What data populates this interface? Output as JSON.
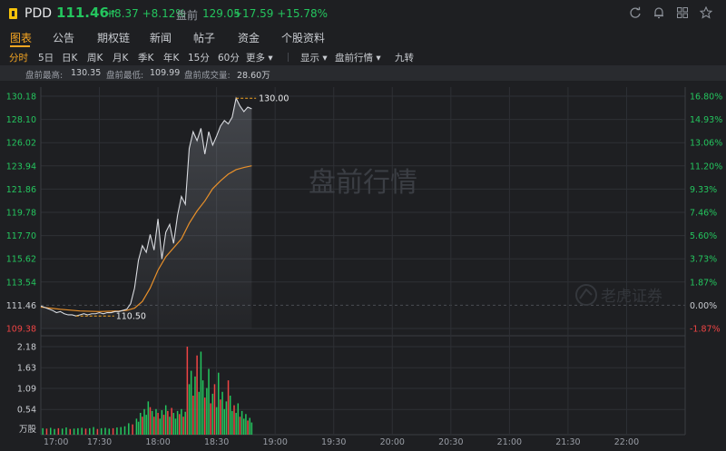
{
  "header": {
    "ticker": "PDD",
    "last_price": "111.46",
    "arrow": "↑",
    "change": "+8.37 +8.12%",
    "premarket_label": "盘前",
    "premarket_price": "129.05",
    "premarket_change": "+17.59 +15.78%",
    "icons": [
      "refresh-icon",
      "bell-icon",
      "grid-icon",
      "star-icon"
    ]
  },
  "tabs": [
    "图表",
    "公告",
    "期权链",
    "新闻",
    "帖子",
    "资金",
    "个股资料"
  ],
  "active_tab": 0,
  "periods": [
    "分时",
    "5日",
    "日K",
    "周K",
    "月K",
    "季K",
    "年K",
    "15分",
    "60分",
    "更多",
    "显示",
    "盘前行情",
    "九转"
  ],
  "active_period": 0,
  "stats": {
    "high_label": "盘前最高:",
    "high": "130.35",
    "low_label": "盘前最低:",
    "low": "109.99",
    "vol_label": "盘前成交量:",
    "vol": "28.60万"
  },
  "colors": {
    "up": "#24c55e",
    "down": "#ef4444",
    "accent": "#f5a623",
    "price_line": "#d9dbe0",
    "avg_line": "#e8902a",
    "bg": "#1e1f22"
  },
  "chart_data": {
    "type": "line",
    "watermark": "盘前行情",
    "brand": "老虎证券",
    "price_ticks": [
      "130.18",
      "128.10",
      "126.02",
      "123.94",
      "121.86",
      "119.78",
      "117.70",
      "115.62",
      "113.54",
      "111.46",
      "109.38"
    ],
    "pct_ticks": [
      "16.80%",
      "14.93%",
      "13.06%",
      "11.20%",
      "9.33%",
      "7.46%",
      "5.60%",
      "3.73%",
      "1.87%",
      "0.00%",
      "-1.87%"
    ],
    "price_range": [
      109.38,
      130.18
    ],
    "prev_close": 111.46,
    "high_label": "130.00",
    "low_label": "110.50",
    "volume_ticks": [
      "2.18",
      "1.63",
      "1.09",
      "0.54"
    ],
    "volume_unit": "万股",
    "volume_max": 2.18,
    "time_ticks": [
      "17:00",
      "17:30",
      "18:00",
      "18:30",
      "19:00",
      "19:30",
      "20:00",
      "20:30",
      "21:00",
      "21:30",
      "22:00"
    ],
    "x_range_min": [
      0,
      330
    ],
    "series": [
      {
        "name": "price",
        "x": [
          0,
          3,
          6,
          8,
          10,
          12,
          14,
          16,
          18,
          20,
          22,
          24,
          26,
          28,
          30,
          32,
          34,
          36,
          38,
          40,
          42,
          44,
          46,
          48,
          50,
          52,
          54,
          56,
          58,
          60,
          62,
          64,
          66,
          68,
          70,
          72,
          74,
          76,
          78,
          80,
          82,
          84,
          86,
          88,
          90,
          92,
          94,
          96,
          98,
          100,
          102,
          104,
          106,
          108
        ],
        "y": [
          111.4,
          111.2,
          111.0,
          110.8,
          110.9,
          110.7,
          110.6,
          110.6,
          110.5,
          110.6,
          110.7,
          110.6,
          110.7,
          110.7,
          110.8,
          110.7,
          110.8,
          110.8,
          110.9,
          110.9,
          111.0,
          111.1,
          111.6,
          113.0,
          115.5,
          116.8,
          116.2,
          117.8,
          116.4,
          119.2,
          115.6,
          118.0,
          118.7,
          117.0,
          119.5,
          121.2,
          120.5,
          125.5,
          127.0,
          126.2,
          127.3,
          125.0,
          127.0,
          125.8,
          126.6,
          127.5,
          128.0,
          127.7,
          128.3,
          130.0,
          129.3,
          128.8,
          129.2,
          129.05
        ]
      },
      {
        "name": "avg",
        "x": [
          0,
          10,
          20,
          30,
          40,
          44,
          48,
          52,
          56,
          60,
          64,
          68,
          72,
          76,
          80,
          84,
          88,
          92,
          96,
          100,
          104,
          108
        ],
        "y": [
          111.3,
          111.1,
          110.95,
          110.9,
          110.95,
          111.0,
          111.2,
          111.8,
          113.0,
          114.6,
          115.8,
          116.6,
          117.4,
          118.8,
          119.9,
          120.8,
          121.9,
          122.6,
          123.2,
          123.6,
          123.8,
          123.95
        ]
      }
    ],
    "volume": [
      {
        "x": 1,
        "v": 0.05,
        "up": true
      },
      {
        "x": 3,
        "v": 0.04,
        "up": false
      },
      {
        "x": 5,
        "v": 0.06,
        "up": true
      },
      {
        "x": 7,
        "v": 0.03,
        "up": true
      },
      {
        "x": 9,
        "v": 0.05,
        "up": false
      },
      {
        "x": 11,
        "v": 0.04,
        "up": true
      },
      {
        "x": 13,
        "v": 0.07,
        "up": true
      },
      {
        "x": 15,
        "v": 0.03,
        "up": false
      },
      {
        "x": 17,
        "v": 0.04,
        "up": true
      },
      {
        "x": 19,
        "v": 0.05,
        "up": true
      },
      {
        "x": 21,
        "v": 0.06,
        "up": true
      },
      {
        "x": 23,
        "v": 0.04,
        "up": false
      },
      {
        "x": 25,
        "v": 0.05,
        "up": true
      },
      {
        "x": 27,
        "v": 0.08,
        "up": true
      },
      {
        "x": 29,
        "v": 0.03,
        "up": false
      },
      {
        "x": 31,
        "v": 0.05,
        "up": true
      },
      {
        "x": 33,
        "v": 0.06,
        "up": true
      },
      {
        "x": 35,
        "v": 0.04,
        "up": true
      },
      {
        "x": 37,
        "v": 0.05,
        "up": false
      },
      {
        "x": 39,
        "v": 0.07,
        "up": true
      },
      {
        "x": 41,
        "v": 0.08,
        "up": true
      },
      {
        "x": 43,
        "v": 0.1,
        "up": true
      },
      {
        "x": 45,
        "v": 0.18,
        "up": true
      },
      {
        "x": 47,
        "v": 0.15,
        "up": false
      },
      {
        "x": 49,
        "v": 0.3,
        "up": true
      },
      {
        "x": 50,
        "v": 0.22,
        "up": true
      },
      {
        "x": 51,
        "v": 0.45,
        "up": true
      },
      {
        "x": 52,
        "v": 0.35,
        "up": false
      },
      {
        "x": 53,
        "v": 0.55,
        "up": true
      },
      {
        "x": 54,
        "v": 0.4,
        "up": true
      },
      {
        "x": 55,
        "v": 0.75,
        "up": true
      },
      {
        "x": 56,
        "v": 0.6,
        "up": false
      },
      {
        "x": 57,
        "v": 0.5,
        "up": true
      },
      {
        "x": 58,
        "v": 0.35,
        "up": false
      },
      {
        "x": 59,
        "v": 0.55,
        "up": true
      },
      {
        "x": 60,
        "v": 0.45,
        "up": false
      },
      {
        "x": 61,
        "v": 0.3,
        "up": true
      },
      {
        "x": 62,
        "v": 0.52,
        "up": true
      },
      {
        "x": 63,
        "v": 0.4,
        "up": false
      },
      {
        "x": 64,
        "v": 0.65,
        "up": true
      },
      {
        "x": 65,
        "v": 0.5,
        "up": false
      },
      {
        "x": 66,
        "v": 0.35,
        "up": true
      },
      {
        "x": 67,
        "v": 0.58,
        "up": false
      },
      {
        "x": 68,
        "v": 0.45,
        "up": true
      },
      {
        "x": 69,
        "v": 0.3,
        "up": true
      },
      {
        "x": 70,
        "v": 0.5,
        "up": true
      },
      {
        "x": 71,
        "v": 0.42,
        "up": false
      },
      {
        "x": 72,
        "v": 0.55,
        "up": true
      },
      {
        "x": 73,
        "v": 0.35,
        "up": false
      },
      {
        "x": 74,
        "v": 0.48,
        "up": true
      },
      {
        "x": 75,
        "v": 2.18,
        "up": false
      },
      {
        "x": 76,
        "v": 1.2,
        "up": true
      },
      {
        "x": 77,
        "v": 1.55,
        "up": true
      },
      {
        "x": 78,
        "v": 0.9,
        "up": false
      },
      {
        "x": 79,
        "v": 1.4,
        "up": true
      },
      {
        "x": 80,
        "v": 1.95,
        "up": false
      },
      {
        "x": 81,
        "v": 1.0,
        "up": true
      },
      {
        "x": 82,
        "v": 2.05,
        "up": true
      },
      {
        "x": 83,
        "v": 1.3,
        "up": true
      },
      {
        "x": 84,
        "v": 0.85,
        "up": false
      },
      {
        "x": 85,
        "v": 1.1,
        "up": true
      },
      {
        "x": 86,
        "v": 1.6,
        "up": true
      },
      {
        "x": 87,
        "v": 0.7,
        "up": false
      },
      {
        "x": 88,
        "v": 0.95,
        "up": true
      },
      {
        "x": 89,
        "v": 1.2,
        "up": false
      },
      {
        "x": 90,
        "v": 0.6,
        "up": true
      },
      {
        "x": 91,
        "v": 1.5,
        "up": true
      },
      {
        "x": 92,
        "v": 0.8,
        "up": false
      },
      {
        "x": 93,
        "v": 1.0,
        "up": true
      },
      {
        "x": 94,
        "v": 0.55,
        "up": true
      },
      {
        "x": 95,
        "v": 0.75,
        "up": true
      },
      {
        "x": 96,
        "v": 1.3,
        "up": false
      },
      {
        "x": 97,
        "v": 0.9,
        "up": true
      },
      {
        "x": 98,
        "v": 0.5,
        "up": true
      },
      {
        "x": 99,
        "v": 0.65,
        "up": false
      },
      {
        "x": 100,
        "v": 0.45,
        "up": true
      },
      {
        "x": 101,
        "v": 0.7,
        "up": true
      },
      {
        "x": 102,
        "v": 0.35,
        "up": false
      },
      {
        "x": 103,
        "v": 0.5,
        "up": true
      },
      {
        "x": 104,
        "v": 0.3,
        "up": true
      },
      {
        "x": 105,
        "v": 0.42,
        "up": true
      },
      {
        "x": 106,
        "v": 0.25,
        "up": false
      },
      {
        "x": 107,
        "v": 0.32,
        "up": true
      },
      {
        "x": 108,
        "v": 0.2,
        "up": true
      }
    ]
  }
}
